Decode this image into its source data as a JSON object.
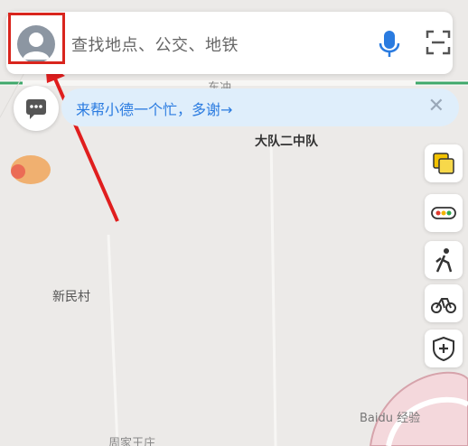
{
  "search": {
    "placeholder": "查找地点、公交、地铁"
  },
  "banner": {
    "text": "来帮小德一个忙，多谢→",
    "close": "✕"
  },
  "map": {
    "labels": {
      "dadui": "大队二中队",
      "xinmin": "新民村",
      "top_partial": "东冲",
      "bottom_partial": "周家王庄"
    }
  },
  "watermark": "Baidu 经验",
  "icons": {
    "avatar": "user-avatar-icon",
    "mic": "microphone-icon",
    "scan": "scan-icon",
    "message": "message-icon",
    "layers": "layers-icon",
    "traffic": "traffic-icon",
    "walk": "walk-icon",
    "bike": "bike-icon",
    "safety": "shield-icon"
  },
  "colors": {
    "accent": "#2a7be0",
    "highlight": "#d9251d"
  }
}
